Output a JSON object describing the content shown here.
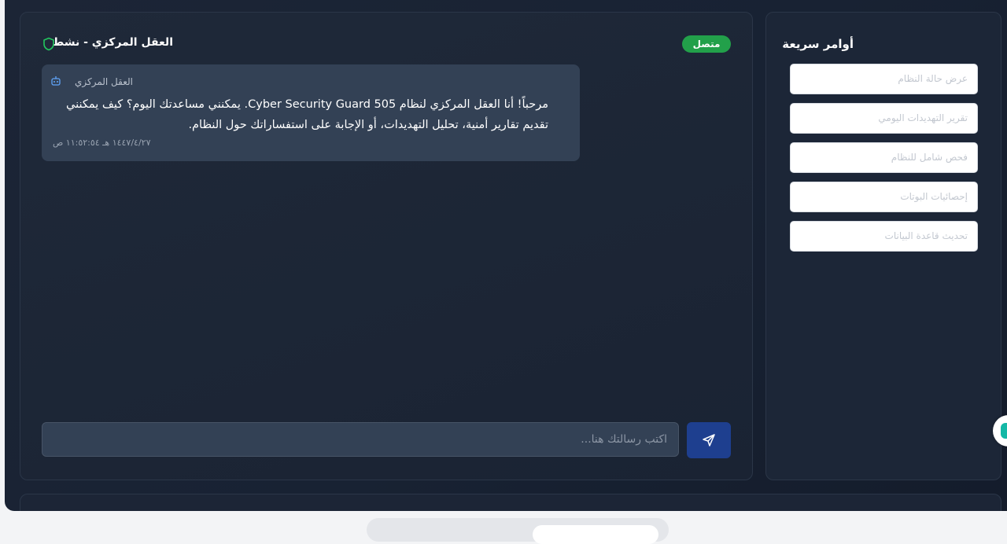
{
  "chat": {
    "title": "العقل المركزي - نشط",
    "status_badge": "متصل",
    "message": {
      "sender": "العقل المركزي",
      "text": "مرحباً! أنا العقل المركزي لنظام Cyber Security Guard 505. يمكنني مساعدتك اليوم؟ كيف يمكنني تقديم تقارير أمنية، تحليل التهديدات، أو الإجابة على استفساراتك حول النظام.",
      "time": "١٤٤٧/٤/٢٧ هـ ١١:٥٢:٥٤ ص"
    },
    "input_placeholder": "اكتب رسالتك هنا...",
    "send_icon": "send-icon",
    "colors": {
      "status": "#22a04a",
      "send_button": "#1e3f8f",
      "accent_icon": "#60a5fa",
      "shield": "#22c55e"
    }
  },
  "quick": {
    "title": "أوامر سريعة",
    "buttons": [
      "عرض حالة النظام",
      "تقرير التهديدات اليومي",
      "فحص شامل للنظام",
      "إحصائيات البوتات",
      "تحديث قاعدة البيانات"
    ]
  }
}
